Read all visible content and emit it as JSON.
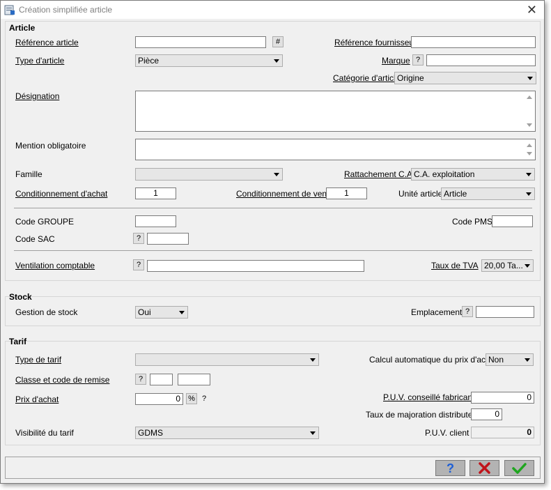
{
  "window": {
    "title": "Création simplifiée article",
    "close_glyph": "✕"
  },
  "article": {
    "section_title": "Article",
    "ref_label": "Référence article",
    "ref_value": "",
    "hash_btn": "#",
    "ref_fourn_label": "Référence fournisseur",
    "ref_fourn_value": "",
    "type_label": "Type d'article",
    "type_value": "Pièce",
    "marque_label": "Marque",
    "marque_value": "",
    "categorie_label": "Catégorie d'article",
    "categorie_value": "Origine",
    "designation_label": "Désignation",
    "mention_label": "Mention obligatoire",
    "famille_label": "Famille",
    "famille_value": "",
    "rattachement_label": "Rattachement C.A.",
    "rattachement_value": "C.A. exploitation",
    "cond_achat_label": "Conditionnement d'achat",
    "cond_achat_value": "1",
    "cond_vente_label": "Conditionnement de vente",
    "cond_vente_value": "1",
    "unite_label": "Unité article",
    "unite_value": "Article",
    "code_groupe_label": "Code GROUPE",
    "code_pms_label": "Code PMS",
    "code_sac_label": "Code SAC",
    "ventilation_label": "Ventilation comptable",
    "tva_label": "Taux de TVA",
    "tva_value": "20,00 Ta..."
  },
  "stock": {
    "section_title": "Stock",
    "gestion_label": "Gestion de stock",
    "gestion_value": "Oui",
    "emplacement_label": "Emplacement"
  },
  "tarif": {
    "section_title": "Tarif",
    "type_label": "Type de tarif",
    "type_value": "",
    "calcul_label": "Calcul automatique du prix d'achat",
    "calcul_value": "Non",
    "classe_label": "Classe et code de remise",
    "prix_achat_label": "Prix d'achat",
    "prix_achat_value": "0",
    "percent_btn": "%",
    "puv_fab_label": "P.U.V. conseillé fabricant",
    "puv_fab_value": "0",
    "taux_maj_label": "Taux de majoration distributeur",
    "taux_maj_value": "0",
    "visibilite_label": "Visibilité du tarif",
    "visibilite_value": "GDMS",
    "puv_client_label": "P.U.V. client",
    "puv_client_value": "0"
  },
  "help_glyph": "?",
  "footer": {
    "help_icon": "help-icon",
    "cancel_icon": "cancel-x-icon",
    "ok_icon": "ok-check-icon",
    "help_color": "#1e5fd6",
    "cancel_color": "#c0141b",
    "ok_color": "#1fa51f"
  }
}
